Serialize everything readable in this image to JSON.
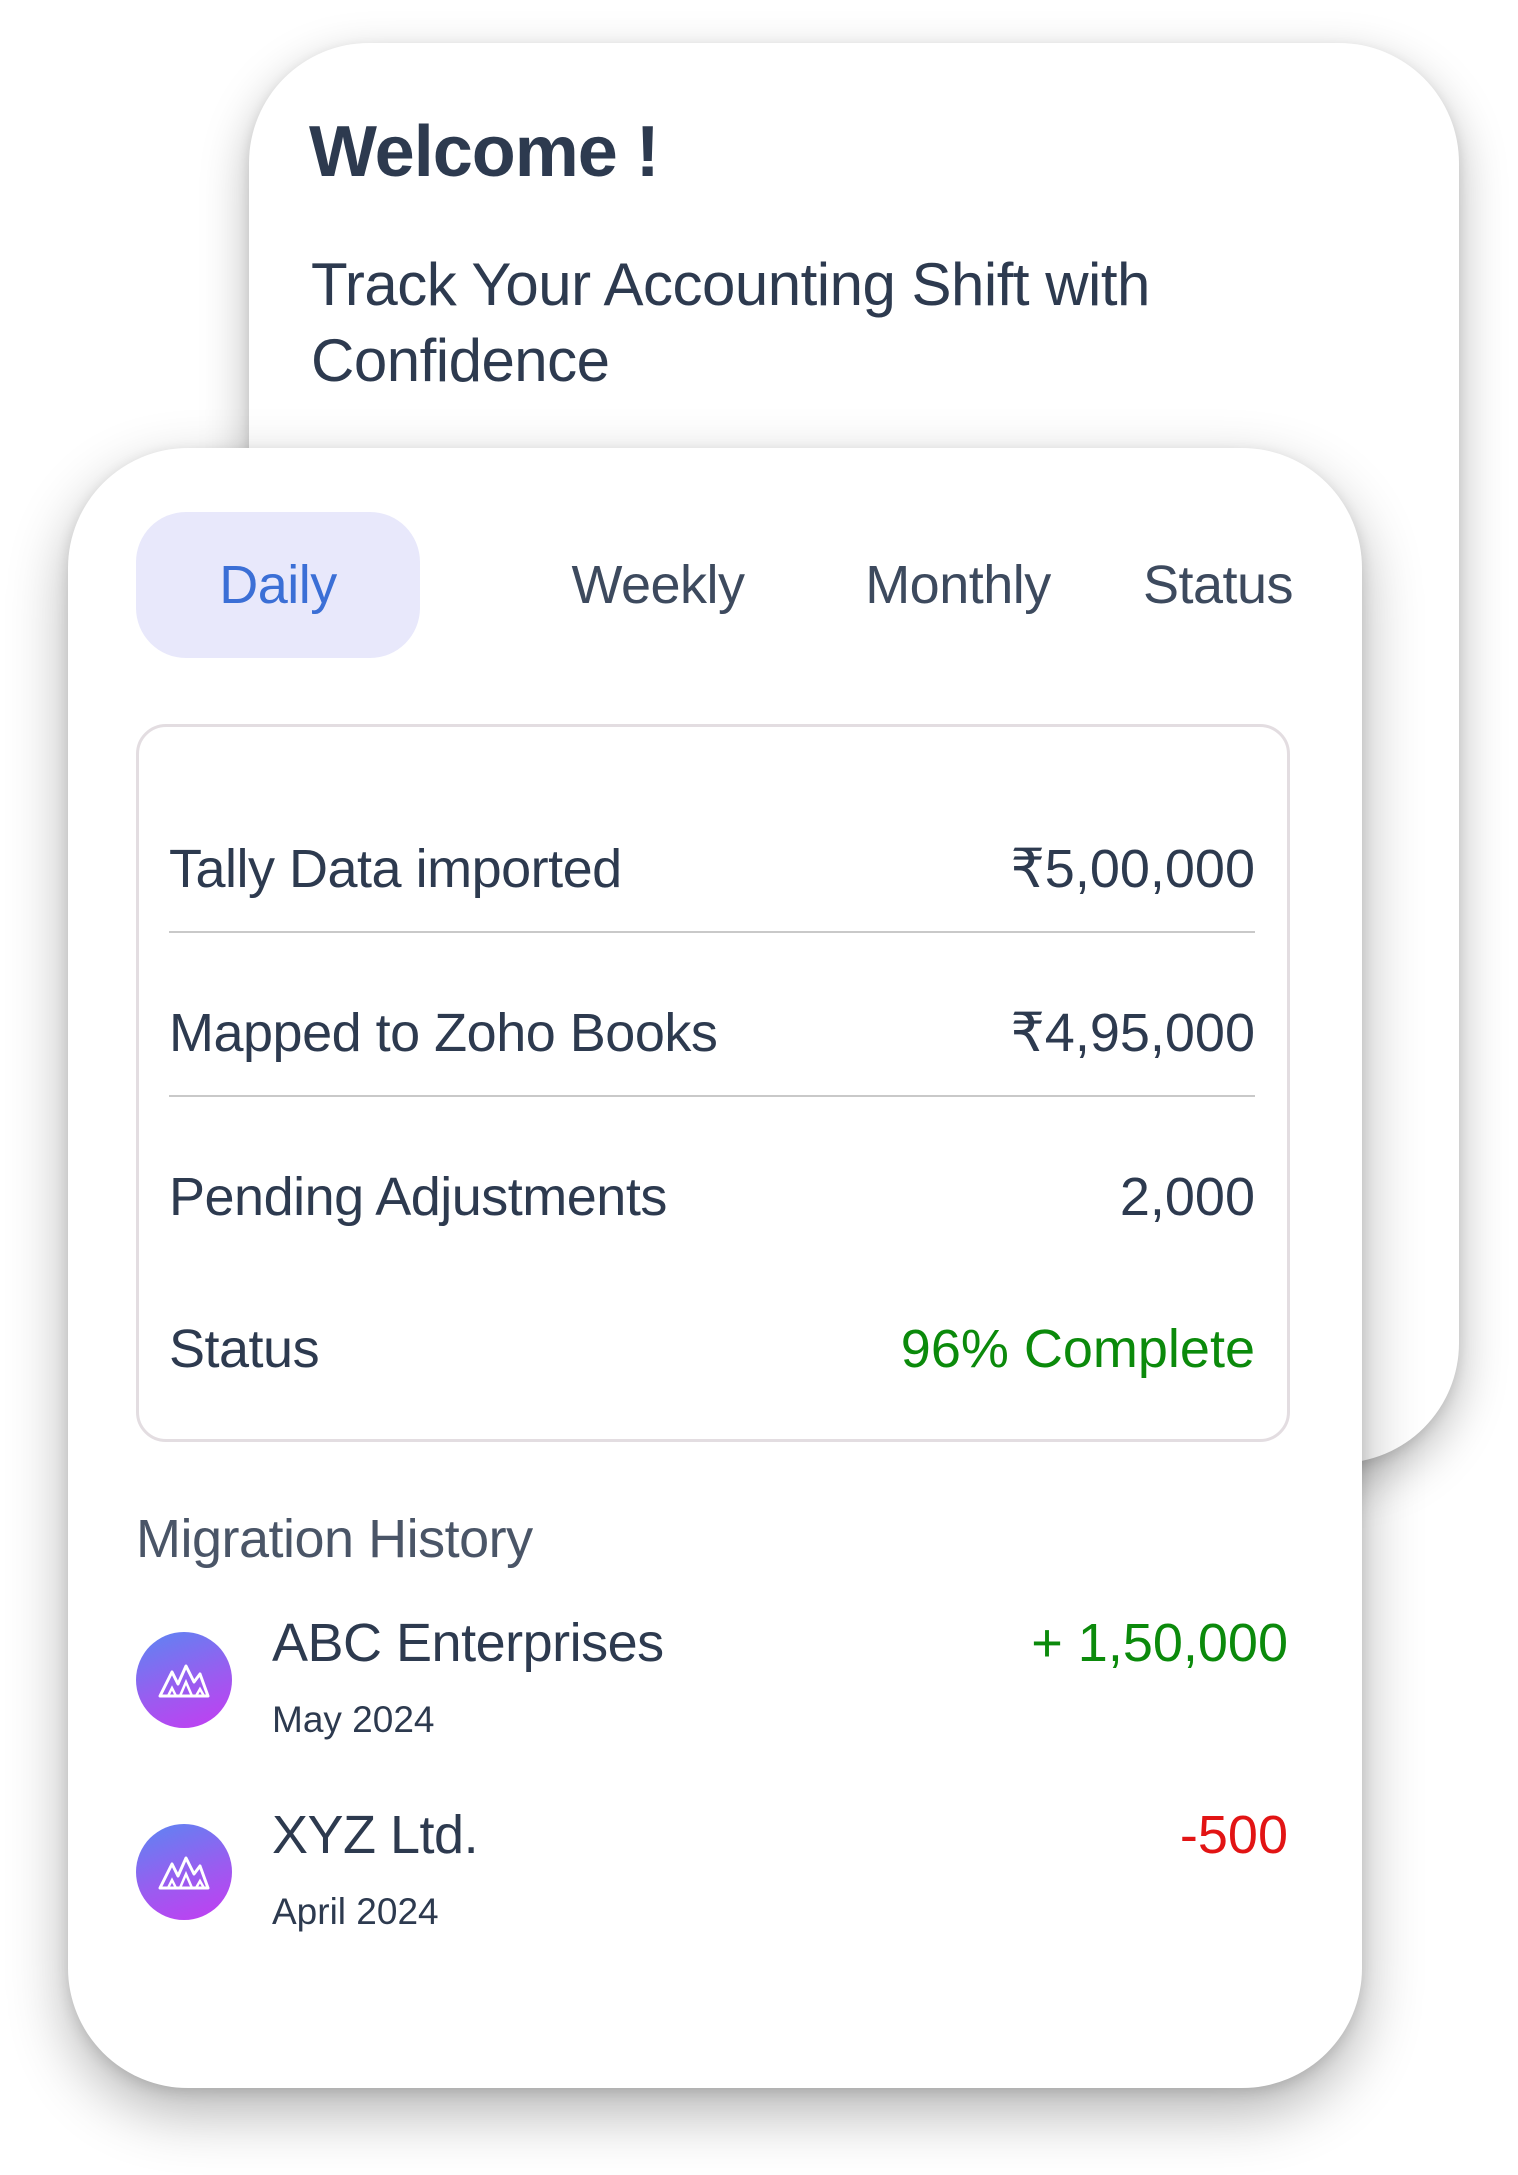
{
  "welcome": {
    "title": "Welcome !",
    "subtitle": "Track Your Accounting Shift with Confidence"
  },
  "tabs": [
    {
      "label": "Daily",
      "active": true
    },
    {
      "label": "Weekly",
      "active": false
    },
    {
      "label": "Monthly",
      "active": false
    },
    {
      "label": "Status",
      "active": false
    }
  ],
  "summary": {
    "rows": [
      {
        "label": "Tally Data imported",
        "value": "₹5,00,000"
      },
      {
        "label": "Mapped to Zoho Books",
        "value": "₹4,95,000"
      },
      {
        "label": "Pending Adjustments",
        "value": "2,000"
      },
      {
        "label": "Status",
        "value": "96% Complete"
      }
    ]
  },
  "history": {
    "title": "Migration History",
    "items": [
      {
        "name": "ABC Enterprises",
        "date": "May 2024",
        "amount": "+ 1,50,000",
        "icon": "company-logo-icon"
      },
      {
        "name": "XYZ Ltd.",
        "date": "April 2024",
        "amount": "-500",
        "icon": "company-logo-icon"
      }
    ]
  },
  "colors": {
    "active_tab_bg": "#e8e8fb",
    "active_tab_text": "#3b6fd6",
    "positive": "#0b8a0b",
    "negative": "#e21414",
    "text": "#2d3a4f"
  }
}
